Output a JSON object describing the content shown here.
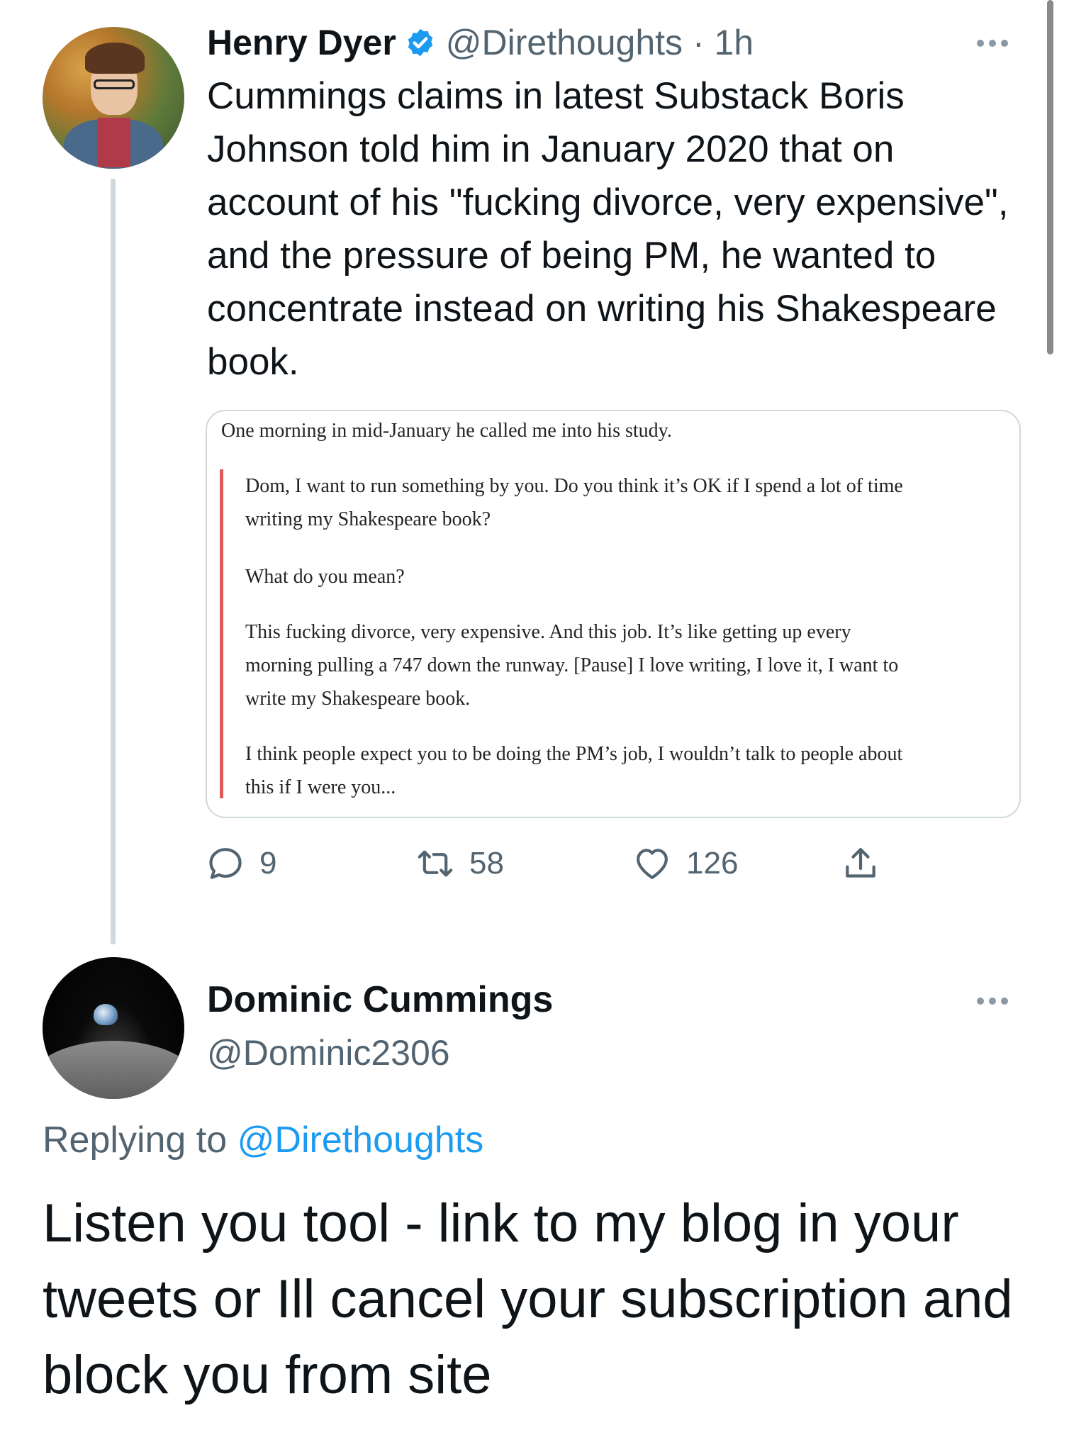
{
  "tweet": {
    "author_name": "Henry Dyer",
    "handle_time": "@Direthoughts · 1h",
    "text": "Cummings claims in latest Substack Boris Johnson told him in January 2020 that on account of his \"fucking divorce, very expensive\", and the pressure of being PM, he wanted to concentrate instead on writing his Shakespeare book.",
    "quote": {
      "intro": "One morning in mid-January he called me into his study.",
      "lines": [
        [
          "Dom, I want to run something by you. Do you think it’s OK if I spend a lot of time",
          "writing my Shakespeare book?"
        ],
        [
          "What do you mean?"
        ],
        [
          "This fucking divorce, very expensive. And this job. It’s like getting up every",
          "morning pulling a 747 down the runway. [Pause] I love writing, I love it, I want to",
          "write my Shakespeare book."
        ],
        [
          "I think people expect you to be doing the PM’s job, I wouldn’t talk to people about",
          "this if I were you..."
        ]
      ]
    },
    "actions": {
      "reply_count": "9",
      "retweet_count": "58",
      "like_count": "126"
    }
  },
  "reply": {
    "author_name": "Dominic Cummings",
    "handle": "@Dominic2306",
    "replying_prefix": "Replying to ",
    "replying_handle": "@Direthoughts",
    "text": "Listen you tool - link to my blog in your tweets or Ill cancel your subscription and block you from site"
  },
  "colors": {
    "accent": "#1d9bf0",
    "quote_bar": "#e05a5a",
    "muted_text": "#536471"
  },
  "icons": [
    "verified-icon",
    "more-icon",
    "reply-icon",
    "retweet-icon",
    "like-icon",
    "share-icon"
  ]
}
